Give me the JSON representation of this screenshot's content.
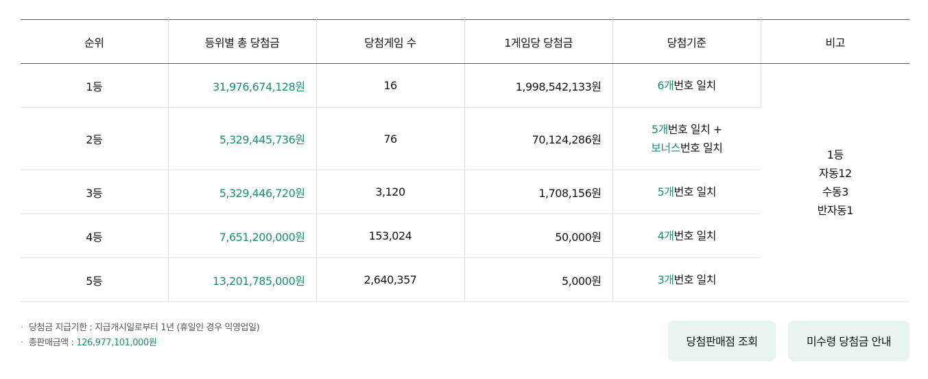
{
  "table": {
    "headers": [
      "순위",
      "등위별 총 당첨금",
      "당첨게임 수",
      "1게임당 당첨금",
      "당첨기준",
      "비고"
    ],
    "rows": [
      {
        "rank": "1등",
        "total": "31,976,674,128원",
        "games": "16",
        "per_game": "1,998,542,133원",
        "criteria": [
          {
            "hl": "6개",
            "text": "번호 일치"
          }
        ]
      },
      {
        "rank": "2등",
        "total": "5,329,445,736원",
        "games": "76",
        "per_game": "70,124,286원",
        "criteria": [
          {
            "hl": "5개",
            "text": "번호 일치 +"
          },
          {
            "hl": "보너스",
            "text": "번호 일치"
          }
        ]
      },
      {
        "rank": "3등",
        "total": "5,329,446,720원",
        "games": "3,120",
        "per_game": "1,708,156원",
        "criteria": [
          {
            "hl": "5개",
            "text": "번호 일치"
          }
        ]
      },
      {
        "rank": "4등",
        "total": "7,651,200,000원",
        "games": "153,024",
        "per_game": "50,000원",
        "criteria": [
          {
            "hl": "4개",
            "text": "번호 일치"
          }
        ]
      },
      {
        "rank": "5등",
        "total": "13,201,785,000원",
        "games": "2,640,357",
        "per_game": "5,000원",
        "criteria": [
          {
            "hl": "3개",
            "text": "번호 일치"
          }
        ]
      }
    ],
    "remarks": [
      "1등",
      "자동12",
      "수동3",
      "반자동1"
    ]
  },
  "notes": [
    {
      "label": "당첨금 지급기한 : 지급개시일로부터 1년 (휴일인 경우 익영업일)",
      "value": ""
    },
    {
      "label": "총판매금액 : ",
      "value": "126,977,101,000원"
    }
  ],
  "buttons": {
    "stores": "당첨판매점 조회",
    "unclaimed": "미수령 당첨금 안내"
  },
  "colors": {
    "accent": "#1b8d74",
    "button_bg": "#e7f4f0"
  }
}
